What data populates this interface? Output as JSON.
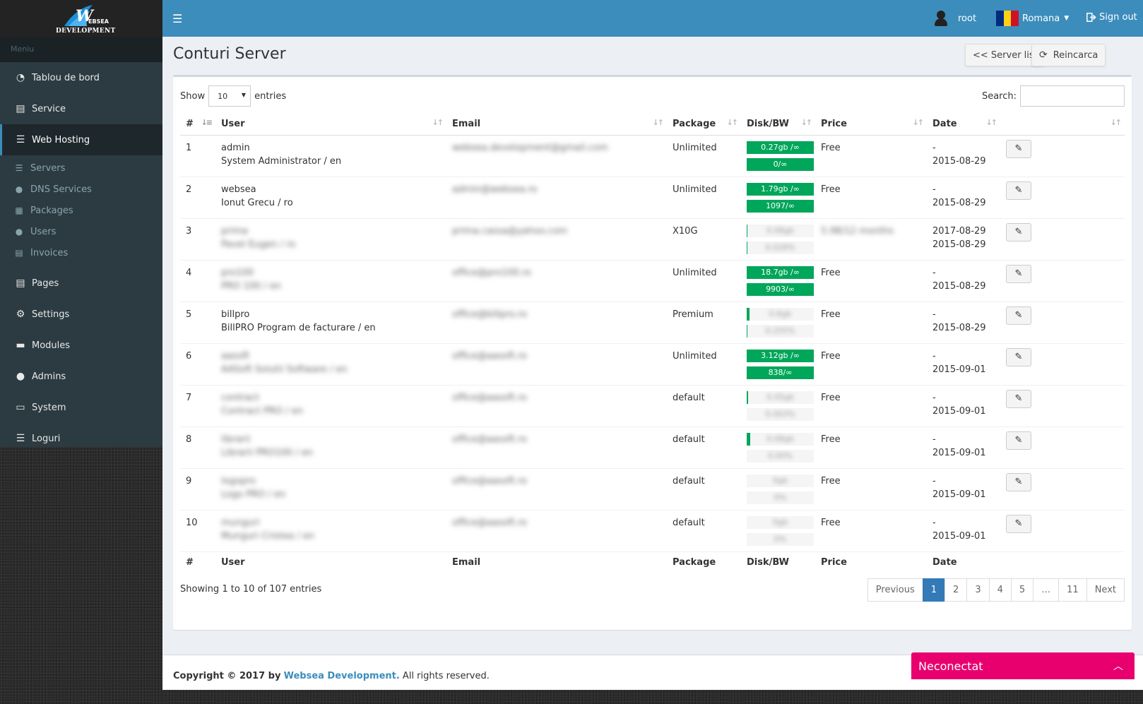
{
  "logo": {
    "w": "W",
    "ws": "EBSEA",
    "dev": "DEVELOPMENT"
  },
  "sidebar": {
    "header": "Meniu",
    "items": [
      {
        "label": "Tablou de bord",
        "icon": "dashboard-icon"
      },
      {
        "label": "Service",
        "icon": "file-icon"
      },
      {
        "label": "Web Hosting",
        "icon": "list-icon",
        "active": true
      },
      {
        "label": "Pages",
        "icon": "file-icon"
      },
      {
        "label": "Settings",
        "icon": "gear-icon"
      },
      {
        "label": "Modules",
        "icon": "folder-icon"
      },
      {
        "label": "Admins",
        "icon": "user-icon"
      },
      {
        "label": "System",
        "icon": "laptop-icon"
      },
      {
        "label": "Loguri",
        "icon": "list-icon"
      }
    ],
    "submenu": [
      {
        "label": "Servers",
        "icon": "list-icon"
      },
      {
        "label": "DNS Services",
        "icon": "globe-icon"
      },
      {
        "label": "Packages",
        "icon": "grid-icon"
      },
      {
        "label": "Users",
        "icon": "user-icon"
      },
      {
        "label": "Invoices",
        "icon": "file-icon"
      }
    ]
  },
  "topbar": {
    "username": "root",
    "language": "Romana",
    "signout": "Sign out",
    "accent": "#3c8dbc",
    "flag_colors": [
      "#002b7f",
      "#fcd116",
      "#ce1126"
    ]
  },
  "page": {
    "title": "Conturi Server",
    "server_list_btn": "<< Server list",
    "reload_btn": "Reincarca"
  },
  "table_controls": {
    "show_label": "Show",
    "entries_label": "entries",
    "length_value": "10",
    "search_label": "Search:"
  },
  "columns": [
    "#",
    "User",
    "Email",
    "Package",
    "Disk/BW",
    "Price",
    "Date"
  ],
  "rows": [
    {
      "n": "1",
      "user": "admin",
      "name": "System Administrator / en",
      "email": "websea.development@gmail.com",
      "package": "Unlimited",
      "disk": "0.27gb /∞",
      "bw": "0/∞",
      "disk_pct": 100,
      "bw_pct": 100,
      "price": "Free",
      "date1": "-",
      "date2": "2015-08-29",
      "blur_user": false
    },
    {
      "n": "2",
      "user": "websea",
      "name": "Ionut Grecu / ro",
      "email": "admin@websea.ro",
      "package": "Unlimited",
      "disk": "1.79gb /∞",
      "bw": "1097/∞",
      "disk_pct": 100,
      "bw_pct": 100,
      "price": "Free",
      "date1": "-",
      "date2": "2015-08-29",
      "blur_user": false
    },
    {
      "n": "3",
      "user": "prima",
      "name": "Pavel Eugen / ro",
      "email": "prima.cassa@yahoo.com",
      "package": "X10G",
      "disk": "0.08gb",
      "bw": "0.028%",
      "disk_pct": 1,
      "bw_pct": 1,
      "price": "5.98/12 months",
      "date1": "2017-08-29",
      "date2": "2015-08-29",
      "blur_user": true,
      "blur_price": true
    },
    {
      "n": "4",
      "user": "pro100",
      "name": "PRO 100 / en",
      "email": "office@pro100.ro",
      "package": "Unlimited",
      "disk": "18.7gb /∞",
      "bw": "9903/∞",
      "disk_pct": 100,
      "bw_pct": 100,
      "price": "Free",
      "date1": "-",
      "date2": "2015-08-29",
      "blur_user": true
    },
    {
      "n": "5",
      "user": "billpro",
      "name": "BillPRO Program de facturare / en",
      "email": "office@billpro.ro",
      "package": "Premium",
      "disk": "0.6gb",
      "bw": "0.255%",
      "disk_pct": 4,
      "bw_pct": 1,
      "price": "Free",
      "date1": "-",
      "date2": "2015-08-29",
      "blur_user": false
    },
    {
      "n": "6",
      "user": "aasoft",
      "name": "AASoft Solutii Software / en",
      "email": "office@aasoft.ro",
      "package": "Unlimited",
      "disk": "3.12gb /∞",
      "bw": "838/∞",
      "disk_pct": 100,
      "bw_pct": 100,
      "price": "Free",
      "date1": "-",
      "date2": "2015-09-01",
      "blur_user": true
    },
    {
      "n": "7",
      "user": "contract",
      "name": "Contract PRO / en",
      "email": "office@aasoft.ro",
      "package": "default",
      "disk": "0.05gb",
      "bw": "0.003%",
      "disk_pct": 2,
      "bw_pct": 0,
      "price": "Free",
      "date1": "-",
      "date2": "2015-09-01",
      "blur_user": true
    },
    {
      "n": "8",
      "user": "librarii",
      "name": "Librarii PRO100 / en",
      "email": "office@aasoft.ro",
      "package": "default",
      "disk": "0.08gb",
      "bw": "0.00%",
      "disk_pct": 5,
      "bw_pct": 0,
      "price": "Free",
      "date1": "-",
      "date2": "2015-09-01",
      "blur_user": true
    },
    {
      "n": "9",
      "user": "logopro",
      "name": "Logo PRO / en",
      "email": "office@aasoft.ro",
      "package": "default",
      "disk": "0gb",
      "bw": "0%",
      "disk_pct": 0,
      "bw_pct": 0,
      "price": "Free",
      "date1": "-",
      "date2": "2015-09-01",
      "blur_user": true
    },
    {
      "n": "10",
      "user": "munguri",
      "name": "Munguri Cristea / en",
      "email": "office@aasoft.ro",
      "package": "default",
      "disk": "0gb",
      "bw": "0%",
      "disk_pct": 0,
      "bw_pct": 0,
      "price": "Free",
      "date1": "-",
      "date2": "2015-09-01",
      "blur_user": true
    }
  ],
  "footer_table": {
    "info": "Showing 1 to 10 of 107 entries"
  },
  "pagination": [
    "Previous",
    "1",
    "2",
    "3",
    "4",
    "5",
    "…",
    "11",
    "Next"
  ],
  "footer": {
    "copyright": "Copyright © 2017 by",
    "company": "Websea Development.",
    "rights": " All rights reserved."
  },
  "chat": {
    "label": "Neconectat"
  }
}
